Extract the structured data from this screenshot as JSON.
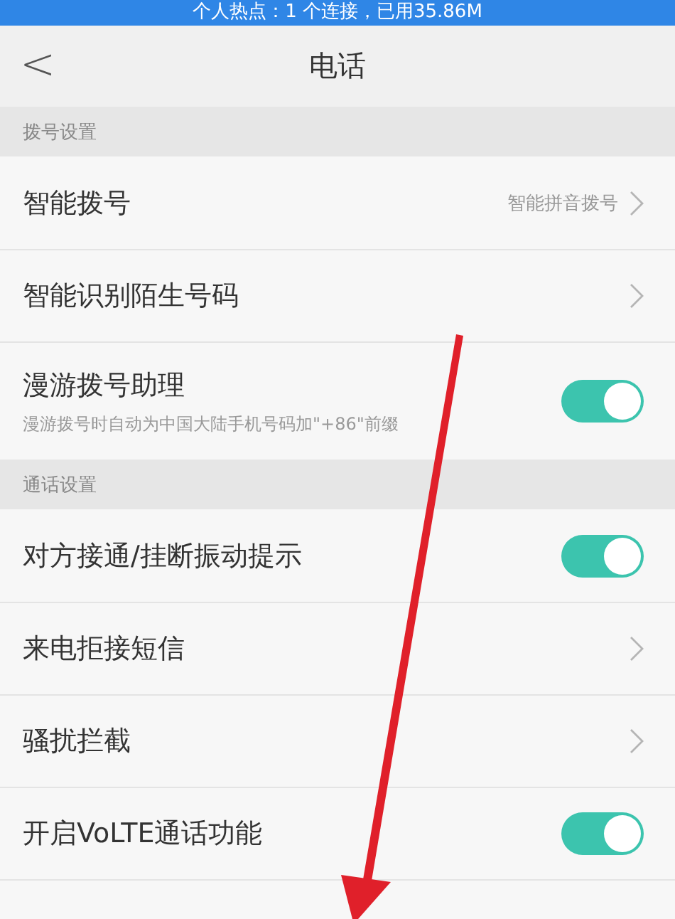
{
  "status_bar": {
    "text": "个人热点：1 个连接，已用35.86M"
  },
  "header": {
    "back": "<",
    "title": "电话"
  },
  "sections": [
    {
      "label": "拨号设置",
      "items": [
        {
          "kind": "link",
          "title": "智能拨号",
          "value": "智能拼音拨号"
        },
        {
          "kind": "link",
          "title": "智能识别陌生号码"
        },
        {
          "kind": "toggle",
          "title": "漫游拨号助理",
          "subtitle": "漫游拨号时自动为中国大陆手机号码加\"+86\"前缀",
          "on": true
        }
      ]
    },
    {
      "label": "通话设置",
      "items": [
        {
          "kind": "toggle",
          "title": "对方接通/挂断振动提示",
          "on": true
        },
        {
          "kind": "link",
          "title": "来电拒接短信"
        },
        {
          "kind": "link",
          "title": "骚扰拦截"
        },
        {
          "kind": "toggle",
          "title": "开启VoLTE通话功能",
          "on": true
        },
        {
          "kind": "cut"
        }
      ]
    }
  ]
}
